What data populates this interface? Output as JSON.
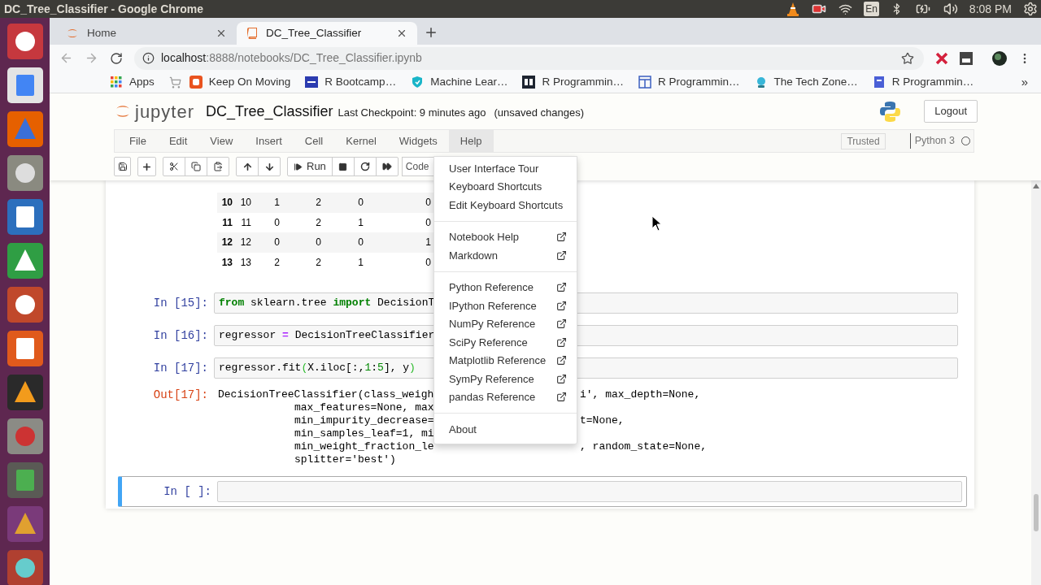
{
  "os_bar": {
    "title": "DC_Tree_Classifier - Google Chrome",
    "keyboard": "En",
    "clock": "8:08 PM"
  },
  "browser": {
    "tabs": [
      {
        "title": "Home",
        "selected": false
      },
      {
        "title": "DC_Tree_Classifier",
        "selected": true
      }
    ],
    "url": {
      "host": "localhost",
      "rest": ":8888/notebooks/DC_Tree_Classifier.ipynb"
    },
    "bookmarks": [
      {
        "label": "Apps"
      },
      {
        "label": "Keep On Moving"
      },
      {
        "label": "R Bootcamp…"
      },
      {
        "label": "Machine Lear…"
      },
      {
        "label": "R Programmin…"
      },
      {
        "label": "R Programmin…"
      },
      {
        "label": "The Tech Zone…"
      },
      {
        "label": "R Programmin…"
      }
    ],
    "bookmarks_overflow": "»"
  },
  "notebook": {
    "logo_text": "jupyter",
    "name": "DC_Tree_Classifier",
    "checkpoint": "Last Checkpoint: 9 minutes ago",
    "autosave": "(unsaved changes)",
    "logout": "Logout",
    "menu": [
      {
        "label": "File",
        "selected": false
      },
      {
        "label": "Edit",
        "selected": false
      },
      {
        "label": "View",
        "selected": false
      },
      {
        "label": "Insert",
        "selected": false
      },
      {
        "label": "Cell",
        "selected": false
      },
      {
        "label": "Kernel",
        "selected": false
      },
      {
        "label": "Widgets",
        "selected": false
      },
      {
        "label": "Help",
        "selected": true
      }
    ],
    "toolbar": {
      "run": "Run",
      "cell_type": "Code"
    },
    "trusted": "Trusted",
    "kernel": "Python 3",
    "kernel_busy": false,
    "table": {
      "rows": [
        [
          "10",
          "10",
          "1",
          "2",
          "0",
          "0"
        ],
        [
          "11",
          "11",
          "0",
          "2",
          "1",
          "0"
        ],
        [
          "12",
          "12",
          "0",
          "0",
          "0",
          "1"
        ],
        [
          "13",
          "13",
          "2",
          "2",
          "1",
          "0"
        ]
      ]
    },
    "cells": [
      {
        "kind": "code",
        "prompt": "In [15]:",
        "selected": false,
        "tokens": [
          {
            "text": "from",
            "kind": "keyword"
          },
          {
            "text": " sklearn.tree ",
            "kind": "plain"
          },
          {
            "text": "import",
            "kind": "keyword"
          },
          {
            "text": " DecisionT",
            "kind": "plain"
          }
        ]
      },
      {
        "kind": "code",
        "prompt": "In [16]:",
        "selected": false,
        "tokens": [
          {
            "text": "regressor ",
            "kind": "plain"
          },
          {
            "text": "=",
            "kind": "operator"
          },
          {
            "text": " DecisionTreeClassifier",
            "kind": "plain"
          }
        ]
      },
      {
        "kind": "code",
        "prompt": "In [17]:",
        "selected": false,
        "tokens": [
          {
            "text": "regressor.fit",
            "kind": "plain"
          },
          {
            "text": "(",
            "kind": "bracket"
          },
          {
            "text": "X.iloc[:,",
            "kind": "plain"
          },
          {
            "text": "1",
            "kind": "number"
          },
          {
            "text": ":",
            "kind": "plain"
          },
          {
            "text": "5",
            "kind": "number"
          },
          {
            "text": "], y",
            "kind": "plain"
          },
          {
            "text": ")",
            "kind": "bracket"
          }
        ]
      },
      {
        "kind": "output",
        "prompt": "Out[17]:",
        "lines": [
          {
            "left": "DecisionTreeClassifier(class_weigh",
            "right": "i', max_depth=None,"
          },
          {
            "left": "max_features=None, max"
          },
          {
            "left": "min_impurity_decrease=",
            "right": "t=None,"
          },
          {
            "left": "min_samples_leaf=1, mi"
          },
          {
            "left": "min_weight_fraction_le",
            "right": ", random_state=None,"
          },
          {
            "left": "splitter='best')"
          }
        ]
      },
      {
        "kind": "code",
        "prompt": "In [ ]:",
        "selected": true
      }
    ]
  },
  "help_menu": {
    "groups": [
      [
        {
          "label": "User Interface Tour",
          "external": false
        },
        {
          "label": "Keyboard Shortcuts",
          "external": false
        },
        {
          "label": "Edit Keyboard Shortcuts",
          "external": false
        }
      ],
      [
        {
          "label": "Notebook Help",
          "external": true
        },
        {
          "label": "Markdown",
          "external": true
        }
      ],
      [
        {
          "label": "Python Reference",
          "external": true
        },
        {
          "label": "IPython Reference",
          "external": true
        },
        {
          "label": "NumPy Reference",
          "external": true
        },
        {
          "label": "SciPy Reference",
          "external": true
        },
        {
          "label": "Matplotlib Reference",
          "external": true
        },
        {
          "label": "SymPy Reference",
          "external": true
        },
        {
          "label": "pandas Reference",
          "external": true
        }
      ],
      [
        {
          "label": "About",
          "external": false
        }
      ]
    ]
  }
}
